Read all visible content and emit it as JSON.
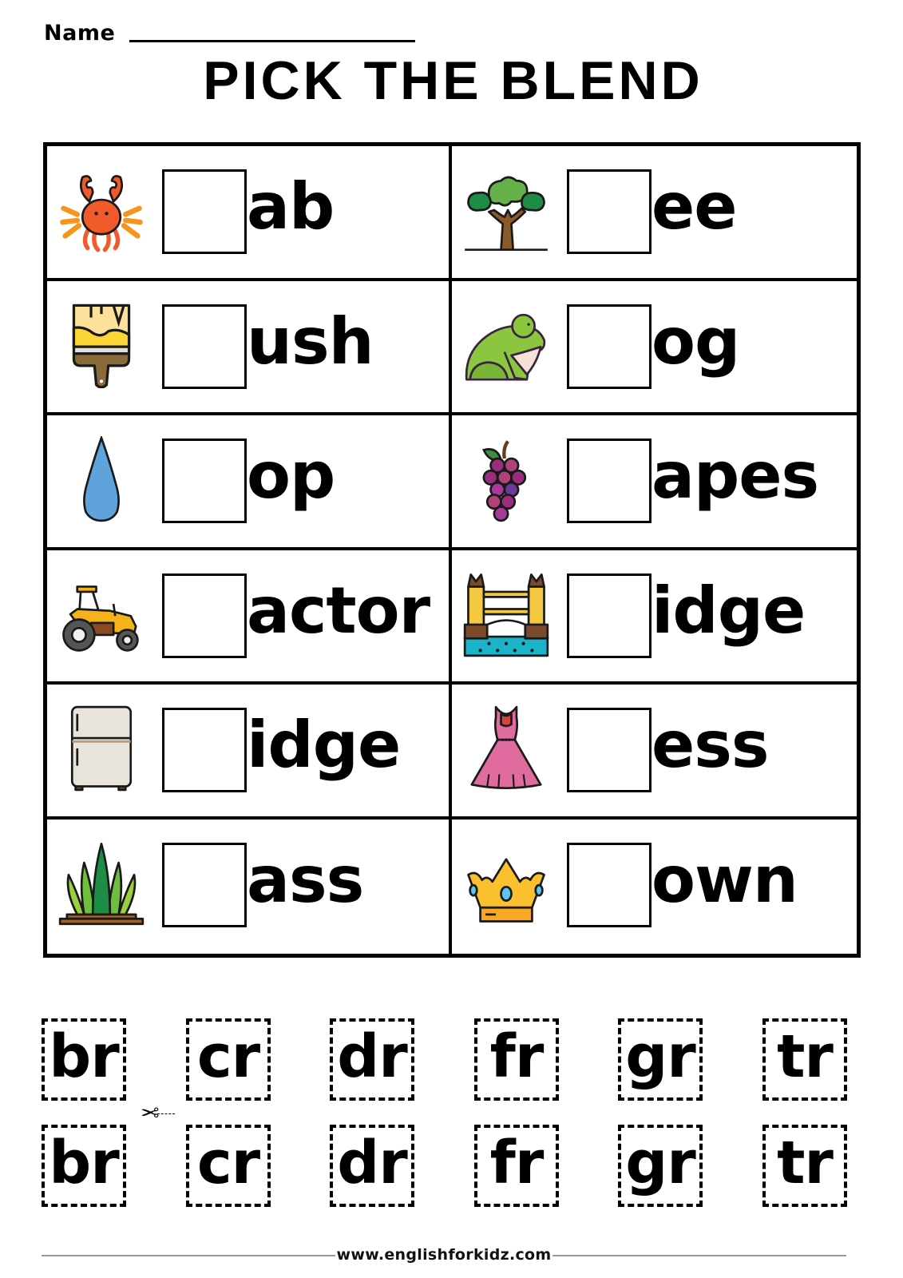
{
  "header": {
    "name_label": "Name",
    "title": "PICK THE BLEND"
  },
  "worksheet": {
    "rows": [
      {
        "left": {
          "picture": "crab-icon",
          "word_ending": "ab"
        },
        "right": {
          "picture": "tree-icon",
          "word_ending": "ee"
        }
      },
      {
        "left": {
          "picture": "paintbrush-icon",
          "word_ending": "ush"
        },
        "right": {
          "picture": "frog-icon",
          "word_ending": "og"
        }
      },
      {
        "left": {
          "picture": "water-drop-icon",
          "word_ending": "op"
        },
        "right": {
          "picture": "grapes-icon",
          "word_ending": "apes"
        }
      },
      {
        "left": {
          "picture": "tractor-icon",
          "word_ending": "actor"
        },
        "right": {
          "picture": "bridge-icon",
          "word_ending": "idge"
        }
      },
      {
        "left": {
          "picture": "fridge-icon",
          "word_ending": "idge"
        },
        "right": {
          "picture": "dress-icon",
          "word_ending": "ess"
        }
      },
      {
        "left": {
          "picture": "grass-icon",
          "word_ending": "ass"
        },
        "right": {
          "picture": "crown-icon",
          "word_ending": "own"
        }
      }
    ]
  },
  "cutout_cards": {
    "row_1": [
      "br",
      "cr",
      "dr",
      "fr",
      "gr",
      "tr"
    ],
    "row_2": [
      "br",
      "cr",
      "dr",
      "fr",
      "gr",
      "tr"
    ],
    "scissors_icon": "scissors-icon"
  },
  "footer": {
    "website": "www.englishforkidz.com"
  },
  "colors": {
    "crab": "#f15a2b",
    "tree_leaves": "#66b04a",
    "tree_trunk": "#8b5a2b",
    "brush_paint": "#fcd537",
    "frog": "#8cc63f",
    "drop": "#5ea3dc",
    "grapes": "#9b2d7f",
    "tractor": "#f5b31b",
    "bridge_water": "#1ab3c9",
    "fridge": "#e8e4dc",
    "dress": "#e06b9e",
    "grass": "#4caf3f",
    "crown": "#fbc02d"
  }
}
